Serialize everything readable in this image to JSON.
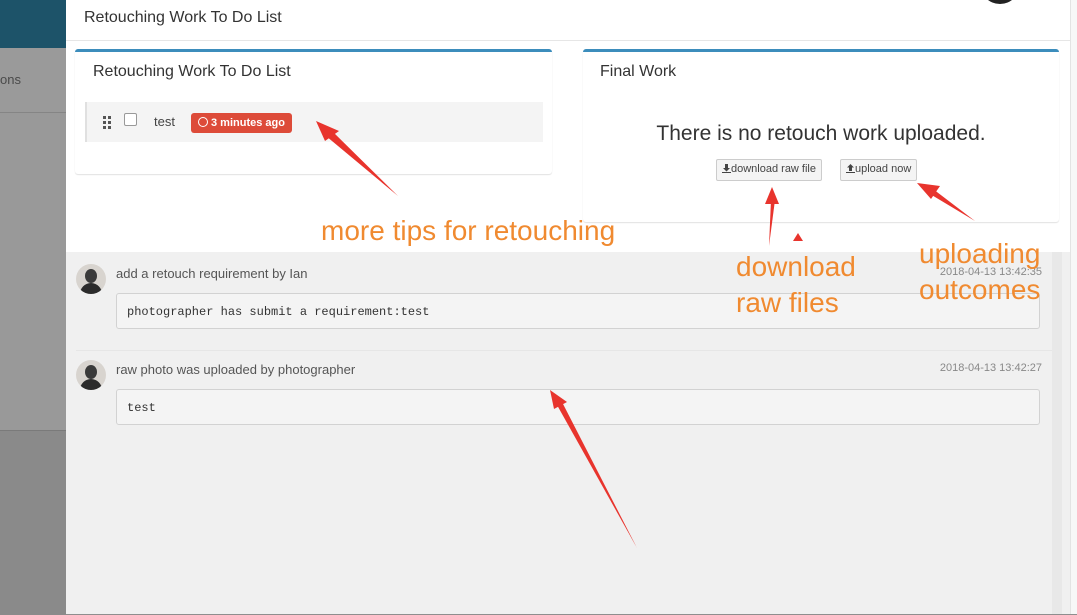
{
  "background": {
    "menu_fragment": "ons"
  },
  "modal": {
    "title": "Retouching Work To Do List"
  },
  "todo_panel": {
    "title": "Retouching Work To Do List",
    "items": [
      {
        "text": "test",
        "badge": "3 minutes ago",
        "checked": false
      }
    ]
  },
  "final_panel": {
    "title": "Final Work",
    "empty_text": "There is no retouch work uploaded.",
    "download_label": "download raw file",
    "upload_label": "upload now"
  },
  "timeline": [
    {
      "title": "add a retouch requirement by Ian",
      "time": "2018-04-13 13:42:35",
      "body": "photographer has submit a requirement:test"
    },
    {
      "title": "raw photo was uploaded by photographer",
      "time": "2018-04-13 13:42:27",
      "body": "test"
    }
  ],
  "annotations": {
    "tips": "more tips for retouching",
    "download_line1": "download",
    "download_line2": "raw files",
    "upload_line1": "uploading",
    "upload_line2": "outcomes"
  },
  "colors": {
    "accent_border": "#3c8dbc",
    "badge": "#dd4b39",
    "annotation_text": "#f08a30",
    "annotation_arrow": "#e8342d"
  },
  "icons": {
    "drag": "drag-handle-icon",
    "clock": "clock-icon",
    "download": "download-icon",
    "upload": "upload-icon"
  }
}
